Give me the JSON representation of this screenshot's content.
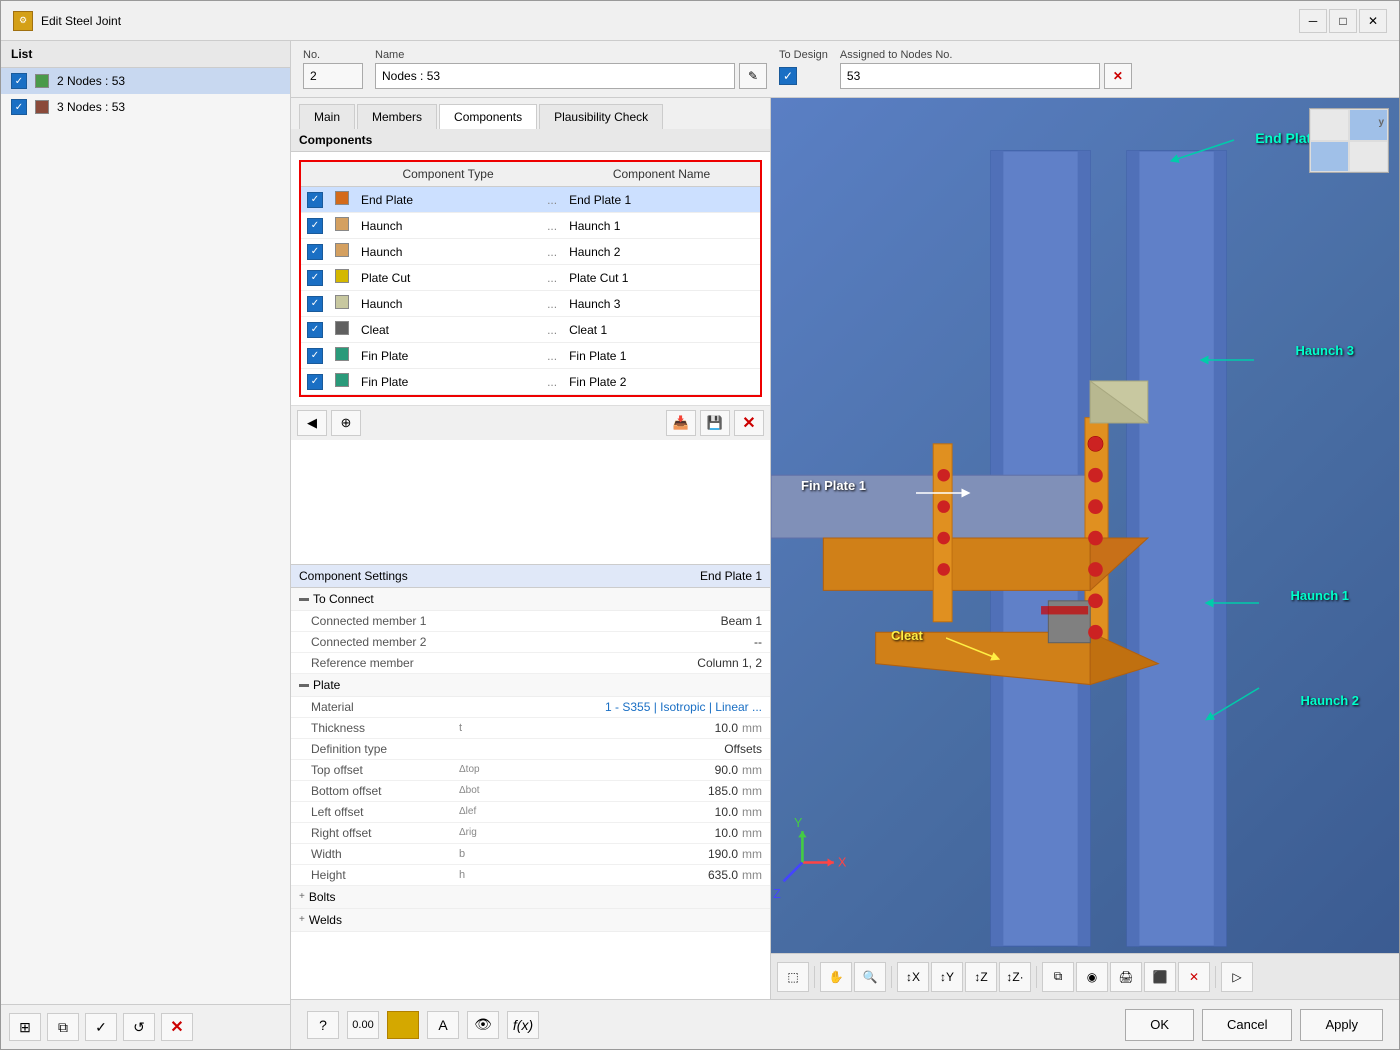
{
  "window": {
    "title": "Edit Steel Joint",
    "icon": "⚙"
  },
  "sidebar": {
    "header": "List",
    "items": [
      {
        "id": 2,
        "label": "2  Nodes : 53",
        "color": "#4a9a4a",
        "selected": true
      },
      {
        "id": 3,
        "label": "3  Nodes : 53",
        "color": "#8a4a3a",
        "selected": false
      }
    ],
    "footer_buttons": [
      "☑",
      "☑",
      "✓",
      "↺",
      "✕"
    ]
  },
  "header": {
    "no_label": "No.",
    "no_value": "2",
    "name_label": "Name",
    "name_value": "Nodes : 53",
    "to_design_label": "To Design",
    "assigned_label": "Assigned to Nodes No.",
    "assigned_value": "53"
  },
  "tabs": [
    "Main",
    "Members",
    "Components",
    "Plausibility Check"
  ],
  "active_tab": "Components",
  "components": {
    "section_title": "Components",
    "col_type": "Component Type",
    "col_name": "Component Name",
    "items": [
      {
        "type": "End Plate",
        "name": "End Plate 1",
        "color": "#d46a1a",
        "checked": true
      },
      {
        "type": "Haunch",
        "name": "Haunch 1",
        "color": "#d4a060",
        "checked": true
      },
      {
        "type": "Haunch",
        "name": "Haunch 2",
        "color": "#d4a060",
        "checked": true
      },
      {
        "type": "Plate Cut",
        "name": "Plate Cut 1",
        "color": "#d4b800",
        "checked": true
      },
      {
        "type": "Haunch",
        "name": "Haunch 3",
        "color": "#c8c8a0",
        "checked": true
      },
      {
        "type": "Cleat",
        "name": "Cleat 1",
        "color": "#606060",
        "checked": true
      },
      {
        "type": "Fin Plate",
        "name": "Fin Plate 1",
        "color": "#2a9a7a",
        "checked": true
      },
      {
        "type": "Fin Plate",
        "name": "Fin Plate 2",
        "color": "#2a9a7a",
        "checked": true
      }
    ]
  },
  "settings": {
    "title": "Component Settings",
    "selected_component": "End Plate 1",
    "to_connect": {
      "label": "To Connect",
      "connected_member_1": "Beam 1",
      "connected_member_2": "--",
      "reference_member": "Column 1, 2"
    },
    "plate": {
      "label": "Plate",
      "material": "1 - S355 | Isotropic | Linear ...",
      "thickness": "10.0",
      "thickness_unit": "mm",
      "definition_type": "Offsets",
      "top_offset": "90.0",
      "top_offset_unit": "mm",
      "bottom_offset": "185.0",
      "bottom_offset_unit": "mm",
      "left_offset": "10.0",
      "left_offset_unit": "mm",
      "right_offset": "10.0",
      "right_offset_unit": "mm",
      "width": "190.0",
      "width_unit": "mm",
      "height": "635.0",
      "height_unit": "mm"
    },
    "bolts_label": "Bolts",
    "welds_label": "Welds"
  },
  "viewport_labels": {
    "end_plate": "End Plate",
    "fin_plate_1": "Fin Plate 1",
    "haunch_1": "Haunch 1",
    "haunch_2": "Haunch 2",
    "haunch_3": "Haunch 3",
    "cleat": "Cleat"
  },
  "footer": {
    "ok_label": "OK",
    "cancel_label": "Cancel",
    "apply_label": "Apply"
  }
}
